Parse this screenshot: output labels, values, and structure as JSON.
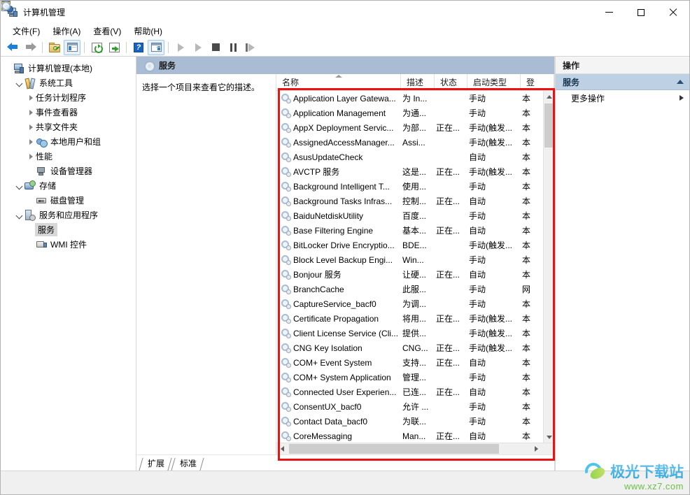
{
  "window": {
    "title": "计算机管理",
    "icon": "computer-management-icon",
    "buttons": {
      "minimize": "–",
      "maximize": "□",
      "close": "✕"
    }
  },
  "menu": [
    {
      "label": "文件(F)",
      "name": "menu-file"
    },
    {
      "label": "操作(A)",
      "name": "menu-action"
    },
    {
      "label": "查看(V)",
      "name": "menu-view"
    },
    {
      "label": "帮助(H)",
      "name": "menu-help"
    }
  ],
  "toolbar": [
    {
      "name": "back-icon",
      "title": "后退"
    },
    {
      "name": "forward-icon",
      "title": "前进"
    },
    {
      "name": "up-folder-icon",
      "title": "上一级"
    },
    {
      "name": "show-hide-tree-icon",
      "title": "显示/隐藏控制台树"
    },
    {
      "name": "refresh-icon",
      "title": "刷新"
    },
    {
      "name": "export-list-icon",
      "title": "导出列表"
    },
    {
      "name": "help-icon",
      "title": "帮助"
    },
    {
      "name": "show-action-pane-icon",
      "title": "显示/隐藏操作窗格"
    },
    {
      "name": "start-service-icon",
      "title": "启动服务"
    },
    {
      "name": "resume-service-icon",
      "title": "恢复服务"
    },
    {
      "name": "stop-service-icon",
      "title": "停止服务"
    },
    {
      "name": "pause-service-icon",
      "title": "暂停服务"
    },
    {
      "name": "restart-service-icon",
      "title": "重启服务"
    }
  ],
  "tree": [
    {
      "label": "计算机管理(本地)",
      "indent": 0,
      "twisty": "none",
      "icon": "computer-icon",
      "selected": false
    },
    {
      "label": "系统工具",
      "indent": 1,
      "twisty": "open",
      "icon": "tools-icon",
      "selected": false
    },
    {
      "label": "任务计划程序",
      "indent": 2,
      "twisty": "closed",
      "icon": "clock-icon",
      "selected": false
    },
    {
      "label": "事件查看器",
      "indent": 2,
      "twisty": "closed",
      "icon": "event-viewer-icon",
      "selected": false
    },
    {
      "label": "共享文件夹",
      "indent": 2,
      "twisty": "closed",
      "icon": "shared-folder-icon",
      "selected": false
    },
    {
      "label": "本地用户和组",
      "indent": 2,
      "twisty": "closed",
      "icon": "users-icon",
      "selected": false
    },
    {
      "label": "性能",
      "indent": 2,
      "twisty": "closed",
      "icon": "performance-icon",
      "selected": false
    },
    {
      "label": "设备管理器",
      "indent": 2,
      "twisty": "none",
      "icon": "device-manager-icon",
      "selected": false
    },
    {
      "label": "存储",
      "indent": 1,
      "twisty": "open",
      "icon": "storage-icon",
      "selected": false
    },
    {
      "label": "磁盘管理",
      "indent": 2,
      "twisty": "none",
      "icon": "disk-management-icon",
      "selected": false
    },
    {
      "label": "服务和应用程序",
      "indent": 1,
      "twisty": "open",
      "icon": "services-apps-icon",
      "selected": false
    },
    {
      "label": "服务",
      "indent": 2,
      "twisty": "none",
      "icon": "service-gear-icon",
      "selected": true
    },
    {
      "label": "WMI 控件",
      "indent": 2,
      "twisty": "none",
      "icon": "wmi-control-icon",
      "selected": false
    }
  ],
  "center": {
    "banner_title": "服务",
    "banner_icon": "service-gear-icon",
    "description_placeholder": "选择一个项目来查看它的描述。",
    "columns": [
      {
        "label": "名称",
        "key": "name",
        "sorted": "asc"
      },
      {
        "label": "描述",
        "key": "description"
      },
      {
        "label": "状态",
        "key": "status"
      },
      {
        "label": "启动类型",
        "key": "startup"
      },
      {
        "label": "登",
        "key": "logon"
      }
    ],
    "rows": [
      {
        "name": "Application Layer Gatewa...",
        "description": "为 In...",
        "status": "",
        "startup": "手动",
        "logon": "本"
      },
      {
        "name": "Application Management",
        "description": "为通...",
        "status": "",
        "startup": "手动",
        "logon": "本"
      },
      {
        "name": "AppX Deployment Servic...",
        "description": "为部...",
        "status": "正在...",
        "startup": "手动(触发...",
        "logon": "本"
      },
      {
        "name": "AssignedAccessManager...",
        "description": "Assi...",
        "status": "",
        "startup": "手动(触发...",
        "logon": "本"
      },
      {
        "name": "AsusUpdateCheck",
        "description": "",
        "status": "",
        "startup": "自动",
        "logon": "本"
      },
      {
        "name": "AVCTP 服务",
        "description": "这是...",
        "status": "正在...",
        "startup": "手动(触发...",
        "logon": "本"
      },
      {
        "name": "Background Intelligent T...",
        "description": "使用...",
        "status": "",
        "startup": "手动",
        "logon": "本"
      },
      {
        "name": "Background Tasks Infras...",
        "description": "控制...",
        "status": "正在...",
        "startup": "自动",
        "logon": "本"
      },
      {
        "name": "BaiduNetdiskUtility",
        "description": "百度...",
        "status": "",
        "startup": "手动",
        "logon": "本"
      },
      {
        "name": "Base Filtering Engine",
        "description": "基本...",
        "status": "正在...",
        "startup": "自动",
        "logon": "本"
      },
      {
        "name": "BitLocker Drive Encryptio...",
        "description": "BDE...",
        "status": "",
        "startup": "手动(触发...",
        "logon": "本"
      },
      {
        "name": "Block Level Backup Engi...",
        "description": "Win...",
        "status": "",
        "startup": "手动",
        "logon": "本"
      },
      {
        "name": "Bonjour 服务",
        "description": "让硬...",
        "status": "正在...",
        "startup": "自动",
        "logon": "本"
      },
      {
        "name": "BranchCache",
        "description": "此服...",
        "status": "",
        "startup": "手动",
        "logon": "网"
      },
      {
        "name": "CaptureService_bacf0",
        "description": "为调...",
        "status": "",
        "startup": "手动",
        "logon": "本"
      },
      {
        "name": "Certificate Propagation",
        "description": "将用...",
        "status": "正在...",
        "startup": "手动(触发...",
        "logon": "本"
      },
      {
        "name": "Client License Service (Cli...",
        "description": "提供...",
        "status": "",
        "startup": "手动(触发...",
        "logon": "本"
      },
      {
        "name": "CNG Key Isolation",
        "description": "CNG...",
        "status": "正在...",
        "startup": "手动(触发...",
        "logon": "本"
      },
      {
        "name": "COM+ Event System",
        "description": "支持...",
        "status": "正在...",
        "startup": "自动",
        "logon": "本"
      },
      {
        "name": "COM+ System Application",
        "description": "管理...",
        "status": "",
        "startup": "手动",
        "logon": "本"
      },
      {
        "name": "Connected User Experien...",
        "description": "已连...",
        "status": "正在...",
        "startup": "自动",
        "logon": "本"
      },
      {
        "name": "ConsentUX_bacf0",
        "description": "允许 ...",
        "status": "",
        "startup": "手动",
        "logon": "本"
      },
      {
        "name": "Contact Data_bacf0",
        "description": "为联...",
        "status": "",
        "startup": "手动",
        "logon": "本"
      },
      {
        "name": "CoreMessaging",
        "description": "Man...",
        "status": "正在...",
        "startup": "自动",
        "logon": "本"
      }
    ],
    "tabs": [
      {
        "label": "扩展",
        "name": "tab-extended",
        "active": false
      },
      {
        "label": "标准",
        "name": "tab-standard",
        "active": true
      }
    ]
  },
  "actions": {
    "title": "操作",
    "group_label": "服务",
    "items": [
      {
        "label": "更多操作",
        "name": "action-more",
        "has_submenu": true
      }
    ]
  },
  "annotation": {
    "color": "#ee1111",
    "shape": "rectangle"
  },
  "watermark": {
    "brand": "极光下载站",
    "url": "www.xz7.com"
  }
}
